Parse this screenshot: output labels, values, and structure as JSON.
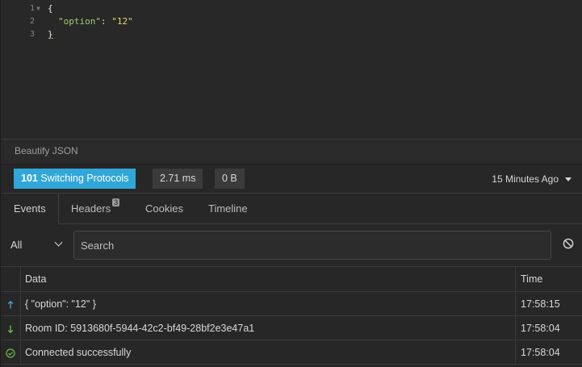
{
  "editor": {
    "lines": [
      {
        "number": "1",
        "text": "{"
      },
      {
        "number": "2",
        "key": "\"option\"",
        "sep": ": ",
        "value": "\"12\""
      },
      {
        "number": "3",
        "text": "}"
      }
    ]
  },
  "beautify": {
    "label": "Beautify JSON"
  },
  "status": {
    "code": "101",
    "text": "Switching Protocols",
    "time": "2.71 ms",
    "size": "0 B",
    "history": "15 Minutes Ago",
    "status_color": "#30a7d8"
  },
  "tabs": {
    "events": "Events",
    "headers": "Headers",
    "headers_count": "3",
    "cookies": "Cookies",
    "timeline": "Timeline"
  },
  "filter": {
    "selected": "All",
    "search_placeholder": "Search",
    "clear_icon": "circle-slash-icon"
  },
  "table": {
    "columns": {
      "data": "Data",
      "time": "Time"
    },
    "rows": [
      {
        "direction": "outgoing",
        "icon": "arrow-up-icon",
        "icon_color": "#4aa3df",
        "data": "{ \"option\": \"12\" }",
        "time": "17:58:15"
      },
      {
        "direction": "incoming",
        "icon": "arrow-down-icon",
        "icon_color": "#6fbf4a",
        "data": "Room ID: 5913680f-5944-42c2-bf49-28bf2e3e47a1",
        "time": "17:58:04"
      },
      {
        "direction": "info",
        "icon": "check-circle-icon",
        "icon_color": "#6fbf4a",
        "data": "Connected successfully",
        "time": "17:58:04"
      }
    ]
  }
}
